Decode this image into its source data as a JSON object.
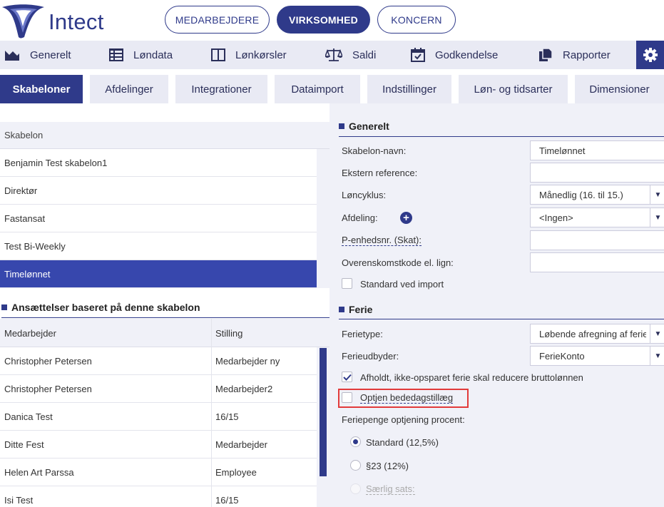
{
  "header": {
    "brand": "Intect",
    "pills": [
      "MEDARBEJDERE",
      "VIRKSOMHED",
      "KONCERN"
    ]
  },
  "mainnav": [
    "Generelt",
    "Løndata",
    "Lønkørsler",
    "Saldi",
    "Godkendelse",
    "Rapporter"
  ],
  "subnav": [
    "Skabeloner",
    "Afdelinger",
    "Integrationer",
    "Dataimport",
    "Indstillinger",
    "Løn- og tidsarter",
    "Dimensioner"
  ],
  "templates": {
    "header": "Skabelon",
    "items": [
      "Benjamin Test skabelon1",
      "Direktør",
      "Fastansat",
      "Test Bi-Weekly",
      "Timelønnet"
    ]
  },
  "employments": {
    "title": "Ansættelser baseret på denne skabelon",
    "columns": [
      "Medarbejder",
      "Stilling"
    ],
    "rows": [
      [
        "Christopher Petersen",
        "Medarbejder ny"
      ],
      [
        "Christopher Petersen",
        "Medarbejder2"
      ],
      [
        "Danica Test",
        "16/15"
      ],
      [
        "Ditte Fest",
        "Medarbejder"
      ],
      [
        "Helen Art Parssa",
        "Employee"
      ],
      [
        "Isi Test",
        "16/15"
      ]
    ]
  },
  "general": {
    "title": "Generelt",
    "template_name_label": "Skabelon-navn:",
    "template_name_value": "Timelønnet",
    "external_ref_label": "Ekstern reference:",
    "external_ref_value": "",
    "pay_cycle_label": "Løncyklus:",
    "pay_cycle_value": "Månedlig (16. til 15.)",
    "department_label": "Afdeling:",
    "department_value": "<Ingen>",
    "punit_label": "P-enhedsnr. (Skat):",
    "punit_value": "",
    "agreement_label": "Overenskomstkode el. lign:",
    "agreement_value": "",
    "default_import_label": "Standard ved import"
  },
  "vacation": {
    "title": "Ferie",
    "type_label": "Ferietype:",
    "type_value": "Løbende afregning af ferie...",
    "provider_label": "Ferieudbyder:",
    "provider_value": "FerieKonto",
    "reduce_label": "Afholdt, ikke-opsparet ferie skal reducere bruttolønnen",
    "accrual_label": "Optjen bededagstillæg",
    "percent_label": "Feriepenge optjening procent:",
    "option_standard": "Standard (12,5%)",
    "option_23": "§23 (12%)",
    "option_special": "Særlig sats:"
  },
  "colors": {
    "primary": "#2f3a8a",
    "selected_row": "#3747ad",
    "panel_bg": "#f0f1f8",
    "highlight": "#e23a3a"
  }
}
